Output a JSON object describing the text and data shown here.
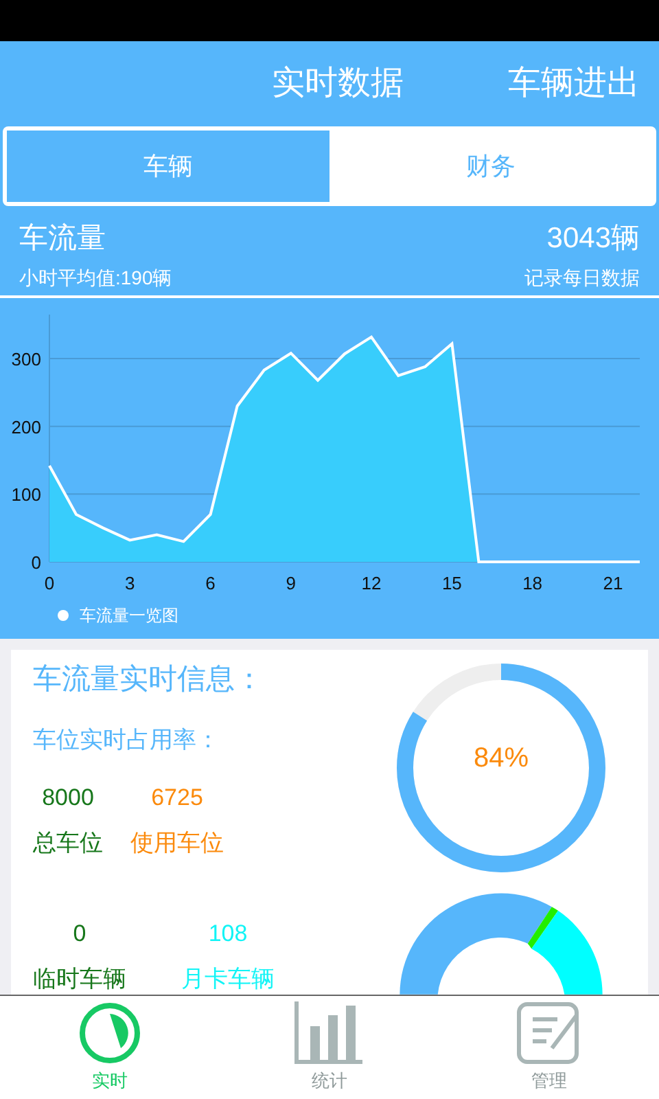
{
  "header": {
    "title": "实时数据",
    "action": "车辆进出"
  },
  "tabs": [
    {
      "label": "车辆",
      "selected": true
    },
    {
      "label": "财务",
      "selected": false
    }
  ],
  "summary": {
    "title": "车流量",
    "total": "3043辆",
    "average": "小时平均值:190辆",
    "record_link": "记录每日数据"
  },
  "chart_data": {
    "type": "area",
    "x": [
      0,
      1,
      2,
      3,
      4,
      5,
      6,
      7,
      8,
      9,
      10,
      11,
      12,
      13,
      14,
      15,
      16,
      17,
      18,
      19,
      20,
      21,
      22
    ],
    "series": [
      {
        "name": "车流量一览图",
        "color": "#38cdfc",
        "values": [
          142,
          70,
          50,
          32,
          40,
          30,
          70,
          230,
          283,
          308,
          268,
          307,
          332,
          275,
          288,
          322,
          0,
          0,
          0,
          0,
          0,
          0,
          0
        ]
      }
    ],
    "grid": true,
    "xlim": [
      0,
      22
    ],
    "ylim": [
      0,
      365
    ],
    "xticks": [
      0,
      3,
      6,
      9,
      12,
      15,
      18,
      21
    ],
    "yticks": [
      0,
      100,
      200,
      300
    ]
  },
  "realtime": {
    "title": "车流量实时信息：",
    "occupancy_label": "车位实时占用率：",
    "stats": [
      {
        "value": "8000",
        "label": "总车位",
        "color": "#17771b"
      },
      {
        "value": "6725",
        "label": "使用车位",
        "color": "#fb8a0c"
      }
    ],
    "occupancy": {
      "text": "84%",
      "level": 0.84
    },
    "vehicle_stats": [
      {
        "value": "0",
        "label": "临时车辆",
        "color": "#17771b"
      },
      {
        "value": "108",
        "label": "月卡车辆",
        "color": "#12f4f6"
      }
    ]
  },
  "bottom_nav": [
    {
      "label": "实时",
      "kind": "clock",
      "selected": true
    },
    {
      "label": "统计",
      "kind": "bars",
      "selected": false
    },
    {
      "label": "管理",
      "kind": "edit",
      "selected": false
    }
  ]
}
